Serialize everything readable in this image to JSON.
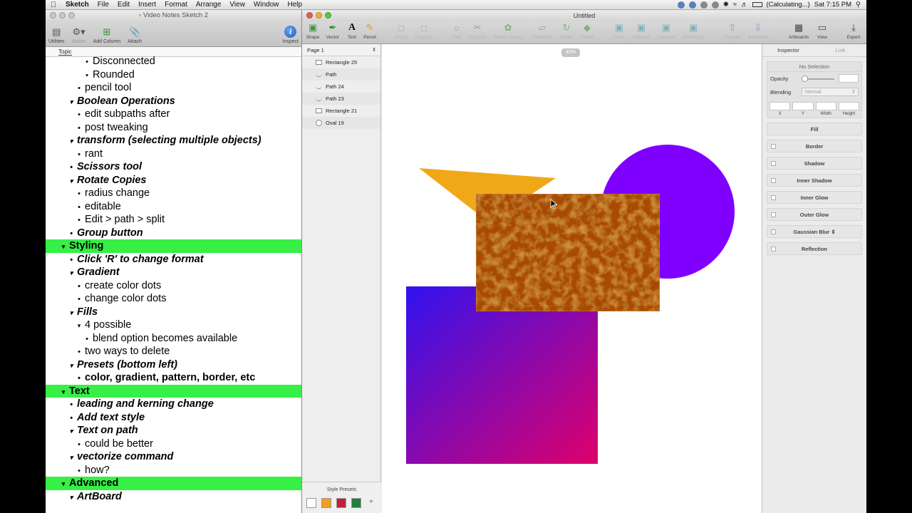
{
  "menubar": {
    "app_name": "Sketch",
    "items": [
      "File",
      "Edit",
      "Insert",
      "Format",
      "Arrange",
      "View",
      "Window",
      "Help"
    ],
    "status_text": "(Calculating...)",
    "clock": "Sat 7:15 PM"
  },
  "outline_window": {
    "title": "Video Notes Sketch 2",
    "toolbar": {
      "utilities": "Utilities",
      "action": "Action",
      "add_column": "Add Column",
      "attach": "Attach",
      "inspect": "Inspect"
    },
    "column_header": "Topic",
    "rows": [
      {
        "text": "Disconnected",
        "level": 3,
        "marker": "bullet",
        "style": "plain",
        "highlight": false
      },
      {
        "text": "Rounded",
        "level": 3,
        "marker": "bullet",
        "style": "plain",
        "highlight": false
      },
      {
        "text": "pencil tool",
        "level": 2,
        "marker": "bullet",
        "style": "plain",
        "highlight": false
      },
      {
        "text": "Boolean Operations",
        "level": 1,
        "marker": "triangle",
        "style": "bold-italic",
        "highlight": false
      },
      {
        "text": "edit subpaths after",
        "level": 2,
        "marker": "bullet",
        "style": "plain",
        "highlight": false
      },
      {
        "text": "post tweaking",
        "level": 2,
        "marker": "bullet",
        "style": "plain",
        "highlight": false
      },
      {
        "text": "transform (selecting multiple objects)",
        "level": 1,
        "marker": "triangle",
        "style": "bold-italic",
        "highlight": false
      },
      {
        "text": "rant",
        "level": 2,
        "marker": "bullet",
        "style": "plain",
        "highlight": false
      },
      {
        "text": "Scissors tool",
        "level": 1,
        "marker": "bullet",
        "style": "bold-italic",
        "highlight": false
      },
      {
        "text": "Rotate Copies",
        "level": 1,
        "marker": "triangle",
        "style": "bold-italic",
        "highlight": false
      },
      {
        "text": "radius change",
        "level": 2,
        "marker": "bullet",
        "style": "plain",
        "highlight": false
      },
      {
        "text": "editable",
        "level": 2,
        "marker": "bullet",
        "style": "plain",
        "highlight": false
      },
      {
        "text": "Edit > path > split",
        "level": 2,
        "marker": "bullet",
        "style": "plain",
        "highlight": false
      },
      {
        "text": "Group button",
        "level": 1,
        "marker": "bullet",
        "style": "bold-italic",
        "highlight": false
      },
      {
        "text": "Styling",
        "level": 0,
        "marker": "triangle",
        "style": "bold",
        "highlight": true
      },
      {
        "text": "Click 'R' to change format",
        "level": 1,
        "marker": "bullet",
        "style": "bold-italic",
        "highlight": false
      },
      {
        "text": "Gradient",
        "level": 1,
        "marker": "triangle",
        "style": "bold-italic",
        "highlight": false
      },
      {
        "text": "create color dots",
        "level": 2,
        "marker": "bullet",
        "style": "plain",
        "highlight": false
      },
      {
        "text": "change color dots",
        "level": 2,
        "marker": "bullet",
        "style": "plain",
        "highlight": false
      },
      {
        "text": "Fills",
        "level": 1,
        "marker": "triangle",
        "style": "bold-italic",
        "highlight": false
      },
      {
        "text": "4 possible",
        "level": 2,
        "marker": "triangle",
        "style": "plain",
        "highlight": false
      },
      {
        "text": "blend option becomes available",
        "level": 3,
        "marker": "bullet",
        "style": "plain",
        "highlight": false
      },
      {
        "text": "two ways to delete",
        "level": 2,
        "marker": "bullet",
        "style": "plain",
        "highlight": false
      },
      {
        "text": "Presets (bottom left)",
        "level": 1,
        "marker": "triangle",
        "style": "bold-italic",
        "highlight": false
      },
      {
        "text": "color, gradient, pattern, border, etc",
        "level": 2,
        "marker": "bullet",
        "style": "bold",
        "highlight": false
      },
      {
        "text": "Text",
        "level": 0,
        "marker": "triangle",
        "style": "bold",
        "highlight": true
      },
      {
        "text": "leading and kerning change",
        "level": 1,
        "marker": "bullet",
        "style": "bold-italic",
        "highlight": false
      },
      {
        "text": "Add text style",
        "level": 1,
        "marker": "bullet",
        "style": "bold-italic",
        "highlight": false
      },
      {
        "text": "Text on path",
        "level": 1,
        "marker": "triangle",
        "style": "bold-italic",
        "highlight": false
      },
      {
        "text": "could be better",
        "level": 2,
        "marker": "bullet",
        "style": "plain",
        "highlight": false
      },
      {
        "text": "vectorize command",
        "level": 1,
        "marker": "triangle",
        "style": "bold-italic",
        "highlight": false
      },
      {
        "text": "how?",
        "level": 2,
        "marker": "bullet",
        "style": "plain",
        "highlight": false
      },
      {
        "text": "Advanced",
        "level": 0,
        "marker": "triangle",
        "style": "bold",
        "highlight": true
      },
      {
        "text": "ArtBoard",
        "level": 1,
        "marker": "triangle",
        "style": "bold-italic",
        "highlight": false
      }
    ],
    "highlight_color": "#36f046"
  },
  "sketch_window": {
    "title": "Untitled",
    "toolbar": [
      {
        "label": "Shape",
        "icon": "shape-icon",
        "enabled": true
      },
      {
        "label": "Vector",
        "icon": "vector-pen-icon",
        "enabled": true
      },
      {
        "label": "Text",
        "icon": "text-icon",
        "enabled": true
      },
      {
        "label": "Pencil",
        "icon": "pencil-icon",
        "enabled": true
      },
      {
        "label": "Group",
        "icon": "group-icon",
        "enabled": false
      },
      {
        "label": "Ungroup",
        "icon": "ungroup-icon",
        "enabled": false
      },
      {
        "label": "Edit",
        "icon": "edit-icon",
        "enabled": false
      },
      {
        "label": "Scissors",
        "icon": "scissors-icon",
        "enabled": false
      },
      {
        "label": "Rotate Copies",
        "icon": "rotate-copies-icon",
        "enabled": false
      },
      {
        "label": "Transform",
        "icon": "transform-icon",
        "enabled": false
      },
      {
        "label": "Rotate",
        "icon": "rotate-icon",
        "enabled": false
      },
      {
        "label": "Flatten",
        "icon": "flatten-icon",
        "enabled": false
      },
      {
        "label": "Union",
        "icon": "union-icon",
        "enabled": false
      },
      {
        "label": "Subtract",
        "icon": "subtract-icon",
        "enabled": false
      },
      {
        "label": "Intersect",
        "icon": "intersect-icon",
        "enabled": false
      },
      {
        "label": "Difference",
        "icon": "difference-icon",
        "enabled": false
      },
      {
        "label": "Forward",
        "icon": "forward-icon",
        "enabled": false
      },
      {
        "label": "Backward",
        "icon": "backward-icon",
        "enabled": false
      },
      {
        "label": "Artboards",
        "icon": "artboards-icon",
        "enabled": true
      },
      {
        "label": "View",
        "icon": "view-icon",
        "enabled": true
      },
      {
        "label": "Export",
        "icon": "export-icon",
        "enabled": true
      }
    ],
    "page_selector": "Page 1",
    "layers": [
      {
        "name": "Rectangle 25",
        "kind": "rect"
      },
      {
        "name": "Path",
        "kind": "path"
      },
      {
        "name": "Path 24",
        "kind": "path"
      },
      {
        "name": "Path 23",
        "kind": "path"
      },
      {
        "name": "Rectangle 21",
        "kind": "rect"
      },
      {
        "name": "Oval 19",
        "kind": "oval"
      }
    ],
    "zoom": "45%",
    "style_presets": {
      "title": "Style Presets",
      "swatches": [
        "#ffffff",
        "#f0a020",
        "#c02040",
        "#208040"
      ],
      "add": "+"
    },
    "inspector": {
      "tab_inspector": "Inspector",
      "tab_link": "Link",
      "no_selection": "No Selection",
      "opacity": "Opacity",
      "blending": "Blending",
      "blending_value": "Normal",
      "x": "X",
      "y": "Y",
      "width": "Width",
      "height": "Height",
      "sections": [
        "Fill",
        "Border",
        "Shadow",
        "Inner Shadow",
        "Inner Glow",
        "Outer Glow",
        "Gaussian Blur",
        "Reflection"
      ]
    },
    "canvas_colors": {
      "triangle": "#f0a818",
      "circle": "#7f00ff",
      "gradient_start": "#3012f0",
      "gradient_end": "#e0006a",
      "texture_rect": "#a84c04"
    }
  }
}
